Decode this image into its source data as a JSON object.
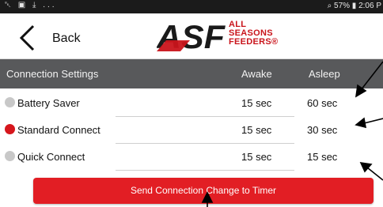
{
  "status_bar": {
    "left_icons": "␇ ▣ ⤓ ...",
    "right_text": "⌕ 57% ▮ 2:06 P"
  },
  "header": {
    "back_label": "Back",
    "logo_mark": "ASF",
    "logo_lines": [
      "ALL",
      "SEASONS",
      "FEEDERS®"
    ]
  },
  "table": {
    "headers": [
      "Connection Settings",
      "Awake",
      "Asleep"
    ],
    "rows": [
      {
        "name": "Battery Saver",
        "awake": "15 sec",
        "asleep": "60 sec",
        "selected": false
      },
      {
        "name": "Standard Connect",
        "awake": "15 sec",
        "asleep": "30 sec",
        "selected": true
      },
      {
        "name": "Quick Connect",
        "awake": "15 sec",
        "asleep": "15 sec",
        "selected": false
      }
    ]
  },
  "send_button": {
    "label": "Send Connection Change to Timer"
  },
  "colors": {
    "accent_red": "#e21e24",
    "header_gray": "#58595b",
    "radio_off": "#c8c8c8",
    "radio_on": "#d6161c"
  }
}
